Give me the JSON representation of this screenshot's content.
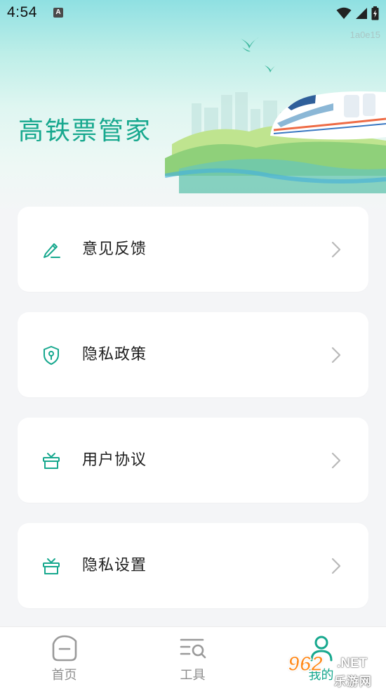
{
  "status_bar": {
    "time": "4:54",
    "notification_badge": "A",
    "icons": [
      "wifi-icon",
      "cell-signal-icon",
      "battery-icon"
    ]
  },
  "header": {
    "build_tag": "1a0e15",
    "app_title": "高铁票管家"
  },
  "menu": {
    "items": [
      {
        "label": "意见反馈",
        "icon": "pencil-icon"
      },
      {
        "label": "隐私政策",
        "icon": "shield-icon"
      },
      {
        "label": "用户协议",
        "icon": "gift-box-icon"
      },
      {
        "label": "隐私设置",
        "icon": "gift-box-icon"
      }
    ]
  },
  "bottom_nav": {
    "items": [
      {
        "label": "首页",
        "icon": "home-icon",
        "active": false
      },
      {
        "label": "工具",
        "icon": "tools-search-icon",
        "active": false
      },
      {
        "label": "我的",
        "icon": "user-icon",
        "active": true
      }
    ]
  },
  "watermark": {
    "number": "962",
    "suffix": ".NET",
    "chinese": "乐游网"
  },
  "colors": {
    "accent": "#17a88e",
    "inactive": "#8e8e8e",
    "card_bg": "#ffffff",
    "page_bg": "#f4f5f7",
    "watermark_orange": "#ff8a1c"
  }
}
